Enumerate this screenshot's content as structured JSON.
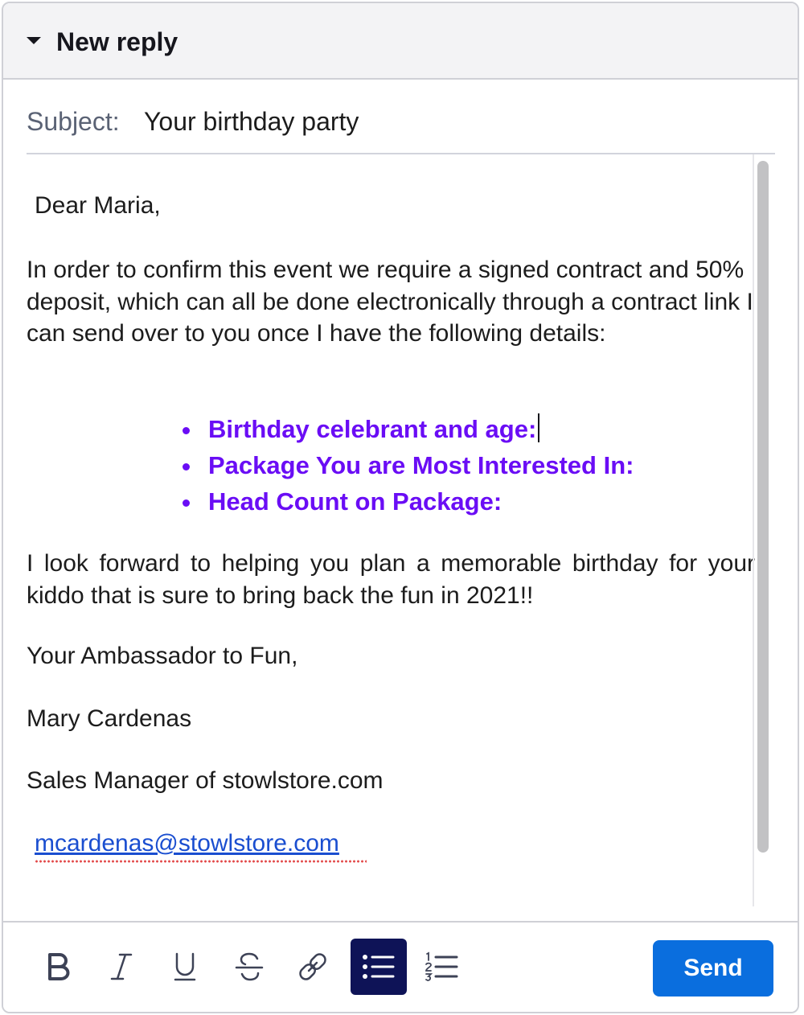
{
  "header": {
    "title": "New reply"
  },
  "subject": {
    "label": "Subject:",
    "value": "Your birthday party"
  },
  "message": {
    "greeting": "Dear Maria,",
    "paragraph1": "In order to confirm this event we require a signed contract and 50% deposit, which can all be done electronically through a contract link I can send over to you once I have the following details:",
    "bullets": [
      "Birthday celebrant and age:",
      "Package You are Most Interested In:",
      "Head Count on Package:"
    ],
    "paragraph2": "I look forward to helping you plan a memorable birthday for your kiddo that is sure to bring back the fun in 2021!!",
    "closing": "Your Ambassador to Fun,",
    "name": "Mary Cardenas",
    "role": "Sales Manager of stowlstore.com",
    "email": "mcardenas@stowlstore.com"
  },
  "toolbar": {
    "buttons": [
      {
        "icon": "bold-icon"
      },
      {
        "icon": "italic-icon"
      },
      {
        "icon": "underline-icon"
      },
      {
        "icon": "strikethrough-icon"
      },
      {
        "icon": "link-icon"
      },
      {
        "icon": "bulleted-list-icon",
        "active": true
      },
      {
        "icon": "numbered-list-icon"
      }
    ],
    "send_label": "Send"
  },
  "colors": {
    "accent": "#0a6ede",
    "bullet_text": "#6a0df5",
    "active_button": "#0e1357",
    "link": "#1a4ed0"
  }
}
